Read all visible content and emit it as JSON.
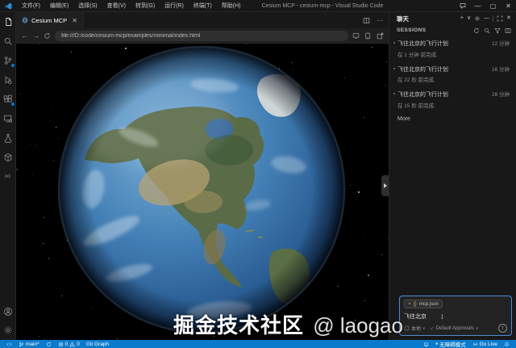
{
  "window": {
    "title": "Cesium MCP - cesium-mcp - Visual Studio Code",
    "menus": [
      {
        "label": "文件(F)"
      },
      {
        "label": "编辑(E)"
      },
      {
        "label": "选择(S)"
      },
      {
        "label": "查看(V)"
      },
      {
        "label": "转到(G)"
      },
      {
        "label": "运行(R)"
      },
      {
        "label": "终端(T)"
      },
      {
        "label": "帮助(H)"
      }
    ],
    "controls": {
      "minimize": "—",
      "maximize": "▢",
      "close": "✕"
    }
  },
  "activity_bar": {
    "items": [
      "explorer",
      "search",
      "source-control",
      "run-and-debug",
      "extensions",
      "remote-explorer",
      "testing",
      "package",
      "infinity-tool",
      "account",
      "settings"
    ],
    "badged_items": [
      "source-control",
      "extensions"
    ]
  },
  "editor": {
    "tab_label": "Cesium MCP",
    "url": "file:///D:/code/cesium-mcp/examples/minimal/index.html"
  },
  "chat": {
    "title": "聊天",
    "sessions_label": "SESSIONS",
    "sessions": [
      {
        "title": "飞往北京的飞行计划",
        "status": "在 1 分钟 前完成.",
        "age": "12 分钟"
      },
      {
        "title": "飞往北京的飞行计划",
        "status": "在 22 秒 前完成.",
        "age": "16 分钟"
      },
      {
        "title": "飞往北京的飞行计划",
        "status": "在 15 秒 前完成.",
        "age": "28 分钟"
      }
    ],
    "more_label": "More",
    "input": {
      "context_chip": "mcp.json",
      "value": "飞往北京"
    },
    "footer": {
      "mode_label": "本地",
      "approvals_label": "Default Approvals",
      "send_glyph": "↑"
    }
  },
  "status_bar": {
    "branch": "main*",
    "errors": "0",
    "warnings": "0",
    "git_graph_label": "Git Graph",
    "accessibility_label": "无障碍模式",
    "go_live_label": "Go Live"
  },
  "watermark": {
    "text": "掘金技术社区",
    "handle": "@ laogao"
  },
  "scene": {
    "description": "Cesium 3D globe showing North America on black starfield"
  },
  "colors": {
    "accent": "#0078d4",
    "statusbar": "#0a7acc",
    "focus_border": "#4b8bd8",
    "ocean": "#3f7cb6",
    "background": "#181818"
  }
}
